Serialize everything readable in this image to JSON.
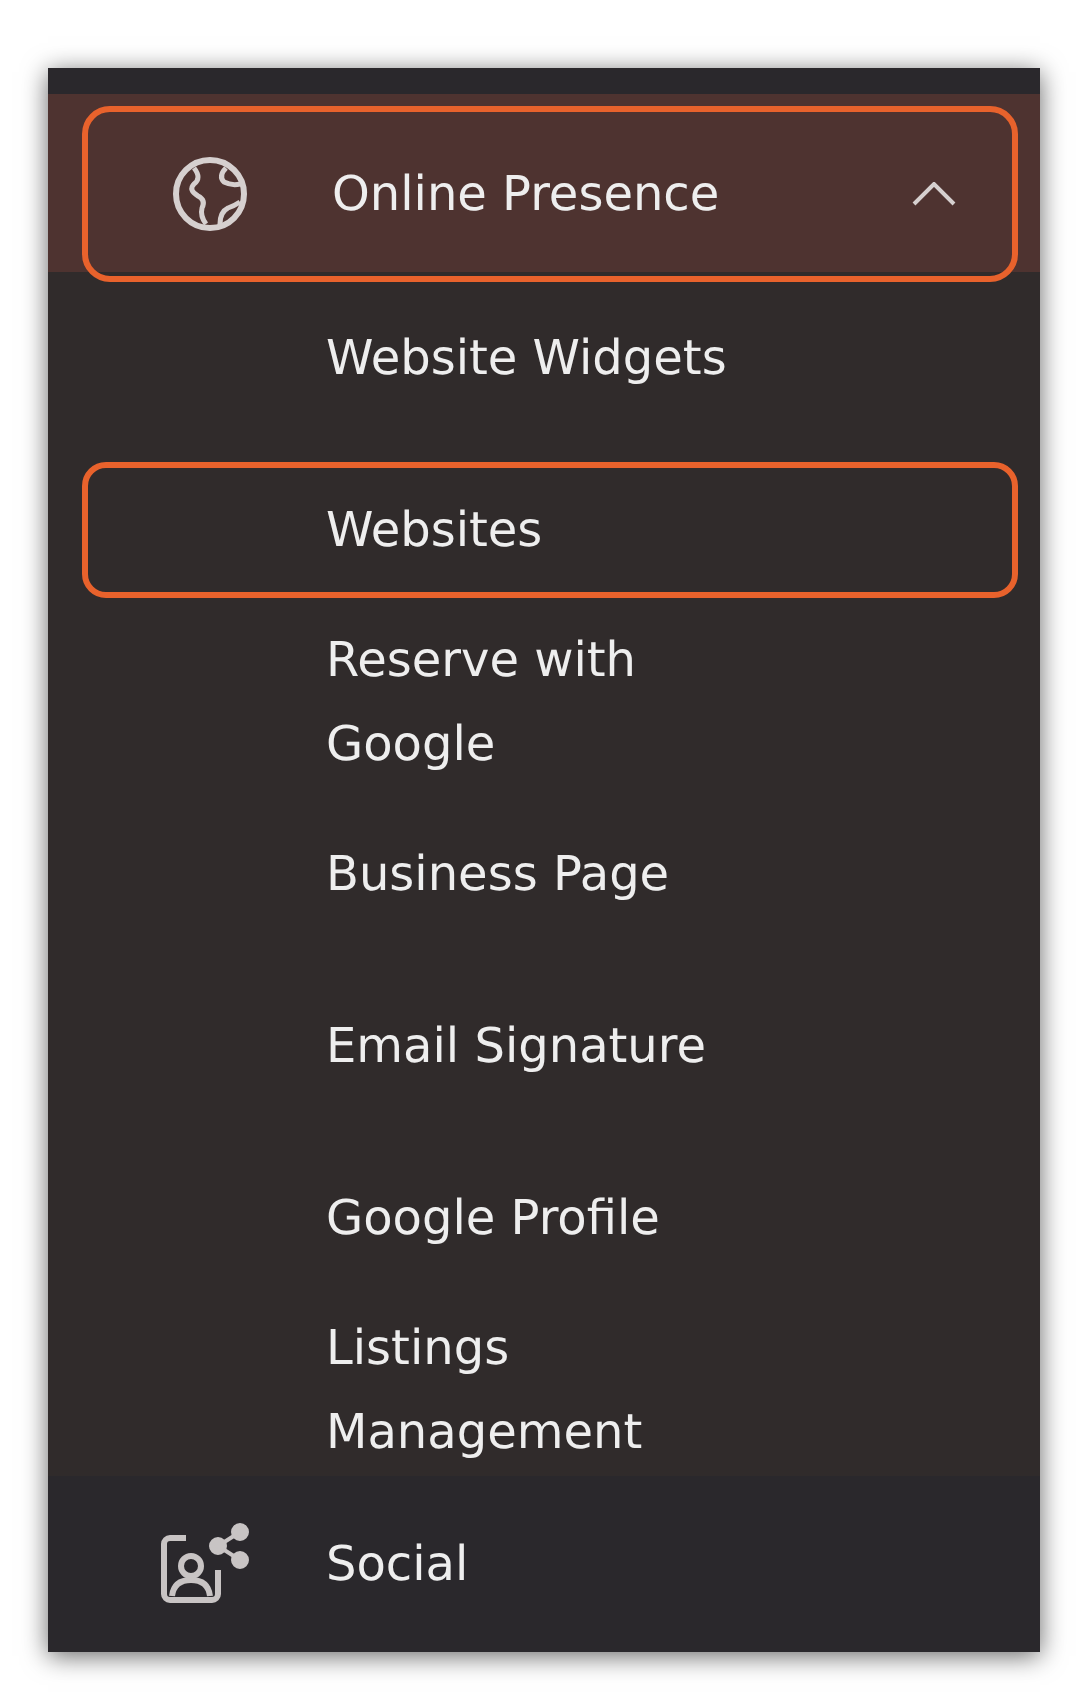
{
  "menu": {
    "section": {
      "label": "Online Presence",
      "expanded": true,
      "highlighted": true
    },
    "items": [
      {
        "label": "Website Widgets",
        "highlighted": false
      },
      {
        "label": "Websites",
        "highlighted": true
      },
      {
        "label": "Reserve with Google",
        "highlighted": false
      },
      {
        "label": "Business Page",
        "highlighted": false
      },
      {
        "label": "Email Signature",
        "highlighted": false
      },
      {
        "label": "Google Profile",
        "highlighted": false
      },
      {
        "label": "Listings Management",
        "highlighted": false
      }
    ],
    "next_section": {
      "label": "Social"
    }
  }
}
